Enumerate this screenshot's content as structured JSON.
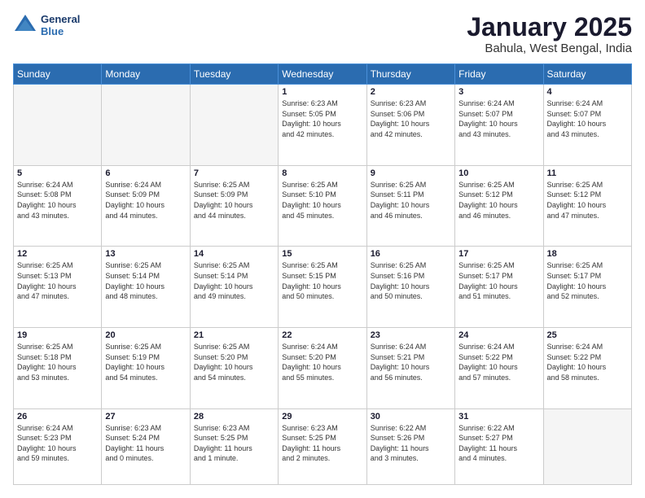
{
  "logo": {
    "line1": "General",
    "line2": "Blue"
  },
  "title": "January 2025",
  "subtitle": "Bahula, West Bengal, India",
  "days_of_week": [
    "Sunday",
    "Monday",
    "Tuesday",
    "Wednesday",
    "Thursday",
    "Friday",
    "Saturday"
  ],
  "weeks": [
    [
      {
        "day": "",
        "empty": true
      },
      {
        "day": "",
        "empty": true
      },
      {
        "day": "",
        "empty": true
      },
      {
        "day": "1",
        "lines": [
          "Sunrise: 6:23 AM",
          "Sunset: 5:05 PM",
          "Daylight: 10 hours",
          "and 42 minutes."
        ]
      },
      {
        "day": "2",
        "lines": [
          "Sunrise: 6:23 AM",
          "Sunset: 5:06 PM",
          "Daylight: 10 hours",
          "and 42 minutes."
        ]
      },
      {
        "day": "3",
        "lines": [
          "Sunrise: 6:24 AM",
          "Sunset: 5:07 PM",
          "Daylight: 10 hours",
          "and 43 minutes."
        ]
      },
      {
        "day": "4",
        "lines": [
          "Sunrise: 6:24 AM",
          "Sunset: 5:07 PM",
          "Daylight: 10 hours",
          "and 43 minutes."
        ]
      }
    ],
    [
      {
        "day": "5",
        "lines": [
          "Sunrise: 6:24 AM",
          "Sunset: 5:08 PM",
          "Daylight: 10 hours",
          "and 43 minutes."
        ]
      },
      {
        "day": "6",
        "lines": [
          "Sunrise: 6:24 AM",
          "Sunset: 5:09 PM",
          "Daylight: 10 hours",
          "and 44 minutes."
        ]
      },
      {
        "day": "7",
        "lines": [
          "Sunrise: 6:25 AM",
          "Sunset: 5:09 PM",
          "Daylight: 10 hours",
          "and 44 minutes."
        ]
      },
      {
        "day": "8",
        "lines": [
          "Sunrise: 6:25 AM",
          "Sunset: 5:10 PM",
          "Daylight: 10 hours",
          "and 45 minutes."
        ]
      },
      {
        "day": "9",
        "lines": [
          "Sunrise: 6:25 AM",
          "Sunset: 5:11 PM",
          "Daylight: 10 hours",
          "and 46 minutes."
        ]
      },
      {
        "day": "10",
        "lines": [
          "Sunrise: 6:25 AM",
          "Sunset: 5:12 PM",
          "Daylight: 10 hours",
          "and 46 minutes."
        ]
      },
      {
        "day": "11",
        "lines": [
          "Sunrise: 6:25 AM",
          "Sunset: 5:12 PM",
          "Daylight: 10 hours",
          "and 47 minutes."
        ]
      }
    ],
    [
      {
        "day": "12",
        "lines": [
          "Sunrise: 6:25 AM",
          "Sunset: 5:13 PM",
          "Daylight: 10 hours",
          "and 47 minutes."
        ]
      },
      {
        "day": "13",
        "lines": [
          "Sunrise: 6:25 AM",
          "Sunset: 5:14 PM",
          "Daylight: 10 hours",
          "and 48 minutes."
        ]
      },
      {
        "day": "14",
        "lines": [
          "Sunrise: 6:25 AM",
          "Sunset: 5:14 PM",
          "Daylight: 10 hours",
          "and 49 minutes."
        ]
      },
      {
        "day": "15",
        "lines": [
          "Sunrise: 6:25 AM",
          "Sunset: 5:15 PM",
          "Daylight: 10 hours",
          "and 50 minutes."
        ]
      },
      {
        "day": "16",
        "lines": [
          "Sunrise: 6:25 AM",
          "Sunset: 5:16 PM",
          "Daylight: 10 hours",
          "and 50 minutes."
        ]
      },
      {
        "day": "17",
        "lines": [
          "Sunrise: 6:25 AM",
          "Sunset: 5:17 PM",
          "Daylight: 10 hours",
          "and 51 minutes."
        ]
      },
      {
        "day": "18",
        "lines": [
          "Sunrise: 6:25 AM",
          "Sunset: 5:17 PM",
          "Daylight: 10 hours",
          "and 52 minutes."
        ]
      }
    ],
    [
      {
        "day": "19",
        "lines": [
          "Sunrise: 6:25 AM",
          "Sunset: 5:18 PM",
          "Daylight: 10 hours",
          "and 53 minutes."
        ]
      },
      {
        "day": "20",
        "lines": [
          "Sunrise: 6:25 AM",
          "Sunset: 5:19 PM",
          "Daylight: 10 hours",
          "and 54 minutes."
        ]
      },
      {
        "day": "21",
        "lines": [
          "Sunrise: 6:25 AM",
          "Sunset: 5:20 PM",
          "Daylight: 10 hours",
          "and 54 minutes."
        ]
      },
      {
        "day": "22",
        "lines": [
          "Sunrise: 6:24 AM",
          "Sunset: 5:20 PM",
          "Daylight: 10 hours",
          "and 55 minutes."
        ]
      },
      {
        "day": "23",
        "lines": [
          "Sunrise: 6:24 AM",
          "Sunset: 5:21 PM",
          "Daylight: 10 hours",
          "and 56 minutes."
        ]
      },
      {
        "day": "24",
        "lines": [
          "Sunrise: 6:24 AM",
          "Sunset: 5:22 PM",
          "Daylight: 10 hours",
          "and 57 minutes."
        ]
      },
      {
        "day": "25",
        "lines": [
          "Sunrise: 6:24 AM",
          "Sunset: 5:22 PM",
          "Daylight: 10 hours",
          "and 58 minutes."
        ]
      }
    ],
    [
      {
        "day": "26",
        "lines": [
          "Sunrise: 6:24 AM",
          "Sunset: 5:23 PM",
          "Daylight: 10 hours",
          "and 59 minutes."
        ]
      },
      {
        "day": "27",
        "lines": [
          "Sunrise: 6:23 AM",
          "Sunset: 5:24 PM",
          "Daylight: 11 hours",
          "and 0 minutes."
        ]
      },
      {
        "day": "28",
        "lines": [
          "Sunrise: 6:23 AM",
          "Sunset: 5:25 PM",
          "Daylight: 11 hours",
          "and 1 minute."
        ]
      },
      {
        "day": "29",
        "lines": [
          "Sunrise: 6:23 AM",
          "Sunset: 5:25 PM",
          "Daylight: 11 hours",
          "and 2 minutes."
        ]
      },
      {
        "day": "30",
        "lines": [
          "Sunrise: 6:22 AM",
          "Sunset: 5:26 PM",
          "Daylight: 11 hours",
          "and 3 minutes."
        ]
      },
      {
        "day": "31",
        "lines": [
          "Sunrise: 6:22 AM",
          "Sunset: 5:27 PM",
          "Daylight: 11 hours",
          "and 4 minutes."
        ]
      },
      {
        "day": "",
        "empty": true
      }
    ]
  ]
}
